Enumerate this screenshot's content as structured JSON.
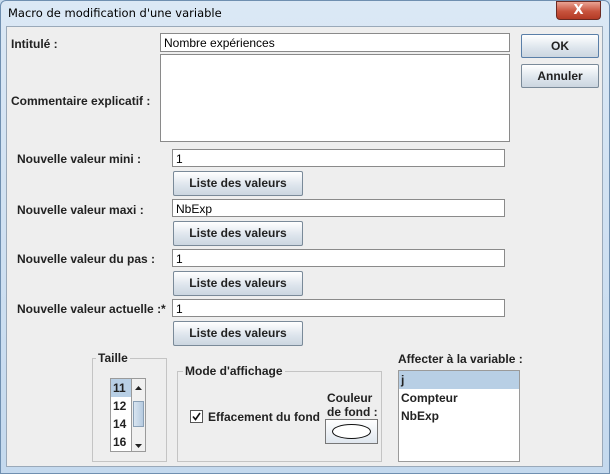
{
  "window": {
    "title": "Macro de modification d'une variable",
    "close_glyph": "X"
  },
  "form": {
    "intitule_label": "Intitulé :",
    "intitule_value": "Nombre expériences",
    "commentaire_label": "Commentaire explicatif :",
    "commentaire_value": "",
    "mini_label": "Nouvelle valeur mini :",
    "mini_value": "1",
    "maxi_label": "Nouvelle valeur maxi :",
    "maxi_value": "NbExp",
    "pas_label": "Nouvelle valeur du pas :",
    "pas_value": "1",
    "actuelle_label": "Nouvelle valeur actuelle :*",
    "actuelle_value": "1",
    "liste_button_label": "Liste des valeurs"
  },
  "actions": {
    "ok_label": "OK",
    "cancel_label": "Annuler"
  },
  "taille": {
    "legend": "Taille",
    "items": [
      "11",
      "12",
      "14",
      "16"
    ],
    "selected": "11"
  },
  "mode": {
    "legend": "Mode d'affichage",
    "checkbox_label": "Effacement du fond",
    "checked": true,
    "couleur_label_line1": "Couleur",
    "couleur_label_line2": "de fond :"
  },
  "affecter": {
    "label": "Affecter à la variable :",
    "items": [
      "j",
      "Compteur",
      "NbExp"
    ],
    "selected": "j"
  },
  "colors": {
    "selection": "#b8cfe5",
    "button_face": "#dce4ec",
    "title_gradient_top": "#dbe8f5"
  },
  "icons": {
    "close": "close-icon",
    "checkbox": "checkbox-checked-icon",
    "scroll_up": "arrow-up-icon",
    "scroll_down": "arrow-down-icon",
    "color_swatch": "ellipse-swatch-icon"
  }
}
